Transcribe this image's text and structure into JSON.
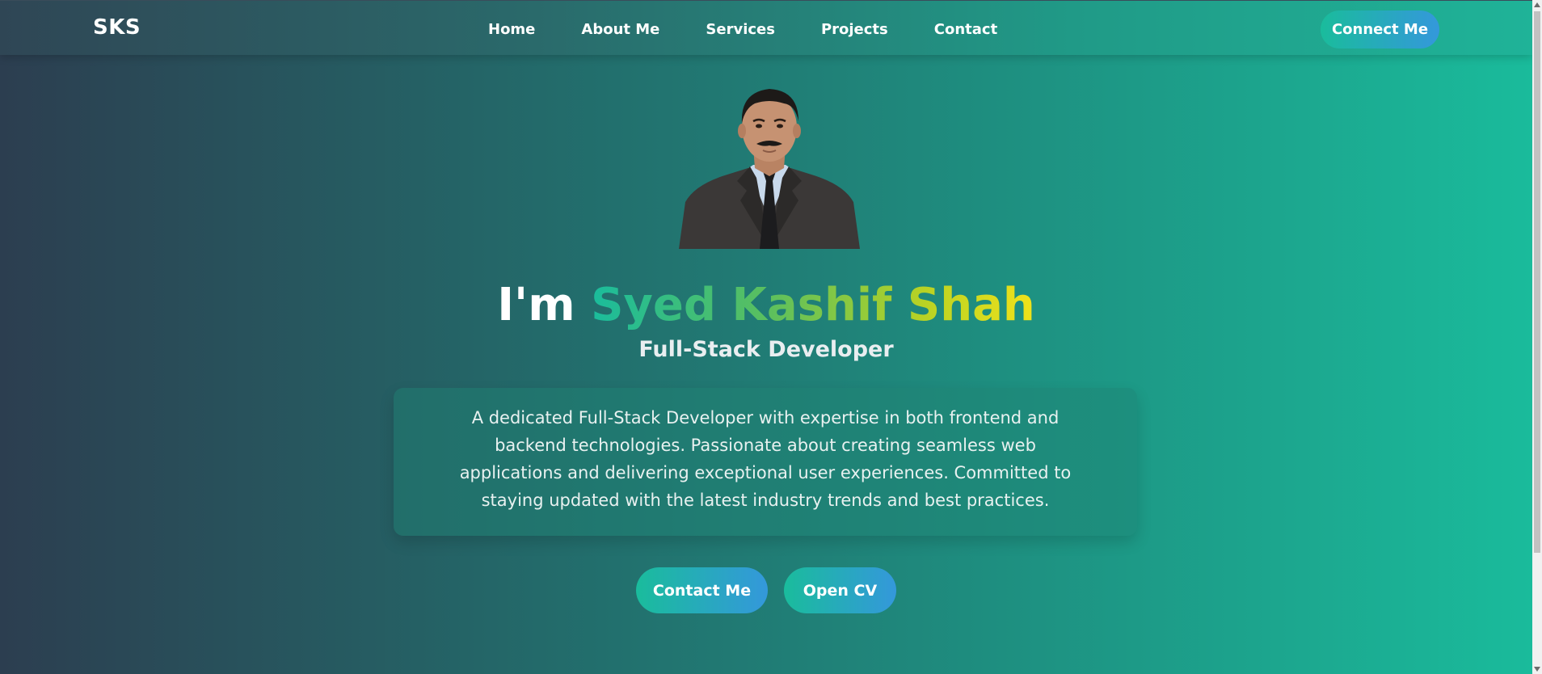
{
  "navbar": {
    "logo": "SKS",
    "links": [
      "Home",
      "About Me",
      "Services",
      "Projects",
      "Contact"
    ],
    "connect_label": "Connect Me"
  },
  "hero": {
    "title_prefix": "I'm",
    "title_name": "Syed Kashif Shah",
    "role": "Full-Stack Developer",
    "about": "A dedicated Full-Stack Developer with expertise in both frontend and backend technologies. Passionate about creating seamless web applications and delivering exceptional user experiences. Committed to staying updated with the latest industry trends and best practices.",
    "buttons": {
      "contact": "Contact Me",
      "cv": "Open CV"
    }
  },
  "colors": {
    "accent_teal": "#1abc9c",
    "accent_blue": "#3498db",
    "name_gradient_end": "#f1e21a",
    "background_dark": "#2c3e50"
  },
  "icons": {
    "avatar": "profile-photo"
  }
}
